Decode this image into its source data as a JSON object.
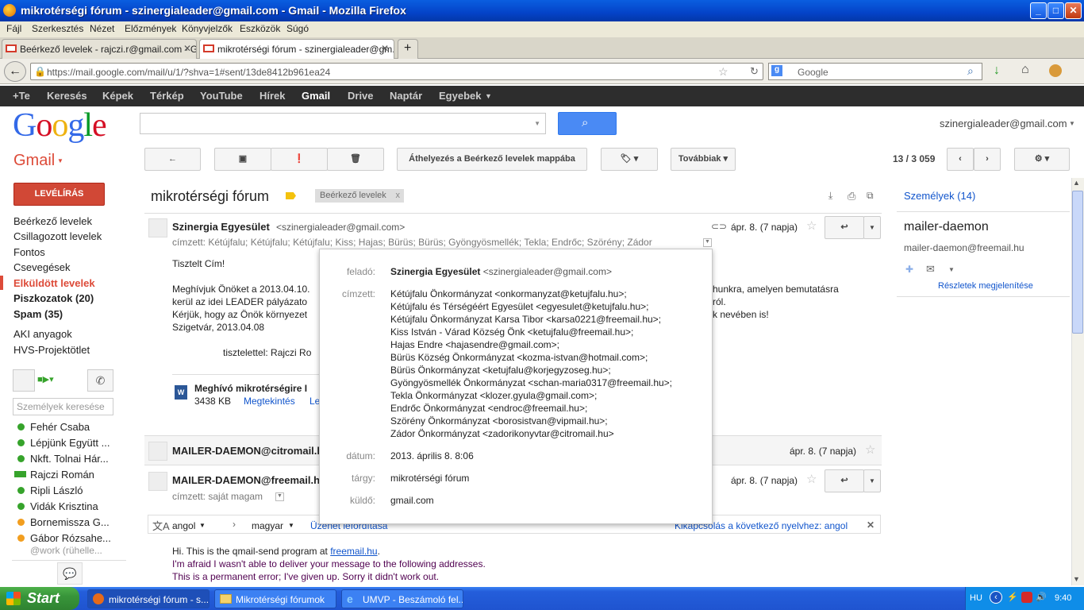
{
  "window": {
    "title": "mikrotérségi fórum - szinergialeader@gmail.com - Gmail - Mozilla Firefox"
  },
  "menu": [
    "Fájl",
    "Szerkesztés",
    "Nézet",
    "Előzmények",
    "Könyvjelzők",
    "Eszközök",
    "Súgó"
  ],
  "tabs": [
    {
      "label": "Beérkező levelek - rajczi.r@gmail.com - G..."
    },
    {
      "label": "mikrotérségi fórum - szinergialeader@gm..."
    }
  ],
  "nav": {
    "url": "https://mail.google.com/mail/u/1/?shva=1#sent/13de8412b961ea24",
    "search_placeholder": "Google"
  },
  "gbar": [
    "+Te",
    "Keresés",
    "Képek",
    "Térkép",
    "YouTube",
    "Hírek",
    "Gmail",
    "Drive",
    "Naptár",
    "Egyebek"
  ],
  "header": {
    "account": "szinergialeader@gmail.com",
    "gmail_label": "Gmail"
  },
  "toolbar": {
    "move_label": "Áthelyezés a Beérkező levelek mappába",
    "more_label": "Továbbiak",
    "count": "13 / 3 059"
  },
  "sidebar": {
    "compose": "LEVÉLÍRÁS",
    "items": [
      "Beérkező levelek",
      "Csillagozott levelek",
      "Fontos",
      "Csevegések",
      "Elküldött levelek",
      "Piszkozatok (20)",
      "Spam (35)",
      "AKI anyagok",
      "HVS-Projektötlet"
    ],
    "people_search_placeholder": "Személyek keresése",
    "contacts": [
      "Fehér Csaba",
      "Lépjünk Együtt ...",
      "Nkft. Tolnai Hár...",
      "Rajczi Román",
      "Ripli László",
      "Vidák Krisztina",
      "Bornemissza G...",
      "Gábor Rózsahe..."
    ],
    "contact_status": "@work (rühelle..."
  },
  "thread": {
    "subject": "mikrotérségi fórum",
    "label": "Beérkező levelek",
    "msg1": {
      "sender": "Szinergia Egyesület",
      "email": "<szinergialeader@gmail.com>",
      "date": "ápr. 8. (7 napja)",
      "to": "címzett: Kétújfalu; Kétújfalu; Kétújfalu; Kiss; Hajas; Bürüs; Bürüs; Gyöngyösmellék; Tekla; Endrőc; Szörény; Zádor",
      "body": [
        "Tisztelt Cím!",
        "Meghívjuk Önöket a 2013.04.10.",
        "kerül az idei LEADER pályázato",
        "Kérjük, hogy az Önök környezet",
        "Szigetvár, 2013.04.08",
        "tisztelettel: Rajczi Ro"
      ],
      "body_right": [
        "hunkra, amelyen bemutatásra",
        "ról.",
        "k nevében is!"
      ],
      "attachment": "Meghívó mikrotérségire I",
      "attachment_size": "3438 KB",
      "attachment_view": "Megtekintés",
      "attachment_dl": "Le"
    },
    "msg2": {
      "sender": "MAILER-DAEMON@citromail.h",
      "date": "ápr. 8. (7 napja)"
    },
    "msg3": {
      "sender": "MAILER-DAEMON@freemail.h",
      "date": "ápr. 8. (7 napja)",
      "to": "címzett: saját magam"
    },
    "translate": {
      "from": "angol",
      "to": "magyar",
      "translate_link": "Üzenet lefordítása",
      "off_link": "Kikapcsolás a következő nyelvhez: angol"
    },
    "bounce": {
      "line1": "Hi. This is the qmail-send program at",
      "link": "freemail.hu",
      "line2": "I'm afraid I wasn't able to deliver your message to the following addresses.",
      "line3": "This is a permanent error; I've given up. Sorry it didn't work out."
    }
  },
  "popup": {
    "from_label": "feladó:",
    "from_name": "Szinergia Egyesület",
    "from_email": "<szinergialeader@gmail.com>",
    "to_label": "címzett:",
    "to": [
      "Kétújfalu Önkormányzat <onkormanyzat@ketujfalu.hu>;",
      "Kétújfalu és Térségéért Egyesület <egyesulet@ketujfalu.hu>;",
      "Kétújfalu Önkormányzat Karsa Tibor <karsa0221@freemail.hu>;",
      "Kiss István - Várad Község Önk <ketujfalu@freemail.hu>;",
      "Hajas Endre <hajasendre@gmail.com>;",
      "Bürüs Község Önkormányzat <kozma-istvan@hotmail.com>;",
      "Bürüs Önkormányzat <ketujfalu@korjegyzoseg.hu>;",
      "Gyöngyösmellék Önkormányzat <schan-maria0317@freemail.hu>;",
      "Tekla Önkormányzat <klozer.gyula@gmail.com>;",
      "Endrőc Önkormányzat <endroc@freemail.hu>;",
      "Szörény Önkormányzat <borosistvan@vipmail.hu>;",
      "Zádor Önkormányzat <zadorikonyvtar@citromail.hu>"
    ],
    "date_label": "dátum:",
    "date": "2013. április 8. 8:06",
    "subject_label": "tárgy:",
    "subject": "mikrotérségi fórum",
    "sent_label": "küldő:",
    "sent_by": "gmail.com"
  },
  "rpanel": {
    "people": "Személyek (14)",
    "name": "mailer-daemon",
    "email": "mailer-daemon@freemail.hu",
    "details": "Részletek megjelenítése"
  },
  "taskbar": {
    "start": "Start",
    "tasks": [
      "mikrotérségi fórum - s...",
      "Mikrotérségi fórumok",
      "UMVP - Beszámoló fel..."
    ],
    "lang": "HU",
    "time": "9:40"
  }
}
